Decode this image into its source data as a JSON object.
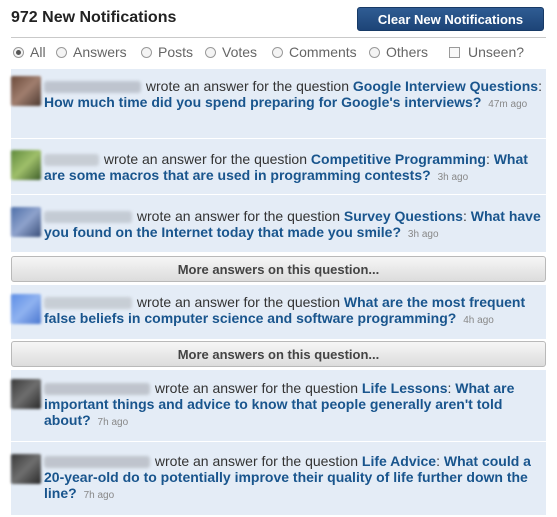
{
  "header": {
    "title": "972 New Notifications",
    "clear_button": "Clear New Notifications"
  },
  "filters": {
    "options": [
      "All",
      "Answers",
      "Posts",
      "Votes",
      "Comments",
      "Others"
    ],
    "selected": "All",
    "unseen_label": "Unseen?"
  },
  "notifications": [
    {
      "action": "wrote an answer for the question",
      "topic": "Google Interview Questions",
      "question": "How much time did you spend preparing for Google's interviews?",
      "time": "47m ago"
    },
    {
      "action": "wrote an answer for the question",
      "topic": "Competitive Programming",
      "question": "What are some macros that are used in programming contests?",
      "time": "3h ago"
    },
    {
      "action": "wrote an answer for the question",
      "topic": "Survey Questions",
      "question": "What have you found on the Internet today that made you smile?",
      "time": "3h ago"
    },
    {
      "action": "wrote an answer for the question",
      "topic": "",
      "question": "What are the most frequent false beliefs in computer science and software programming?",
      "time": "4h ago"
    },
    {
      "action": "wrote an answer for the question",
      "topic": "Life Lessons",
      "question": "What are important things and advice to know that people generally aren't told about?",
      "time": "7h ago"
    },
    {
      "action": "wrote an answer for the question",
      "topic": "Life Advice",
      "question": "What could a 20-year-old do to potentially improve their quality of life further down the line?",
      "time": "7h ago"
    }
  ],
  "more_answers_label": "More answers on this question...",
  "colors": {
    "link": "#19558d",
    "row_bg": "#e4ecf6",
    "button_blue": "#1d4477"
  }
}
